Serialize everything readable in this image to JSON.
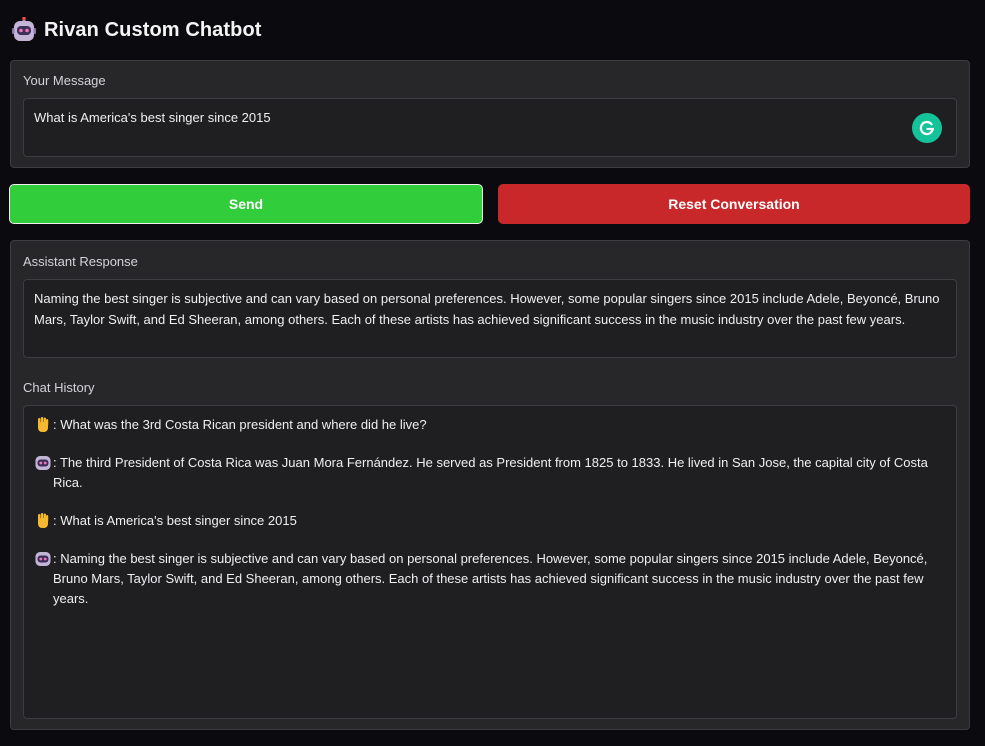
{
  "app": {
    "title": "Rivan Custom Chatbot",
    "icon": "robot-icon"
  },
  "message": {
    "label": "Your Message",
    "value": "What is America's best singer since 2015",
    "grammarly_icon": "grammarly-icon"
  },
  "buttons": {
    "send_label": "Send",
    "reset_label": "Reset Conversation"
  },
  "response": {
    "label": "Assistant Response",
    "text": "Naming the best singer is subjective and can vary based on personal preferences. However, some popular singers since 2015 include Adele, Beyoncé, Bruno Mars, Taylor Swift, and Ed Sheeran, among others. Each of these artists has achieved significant success in the music industry over the past few years."
  },
  "history": {
    "label": "Chat History",
    "entries": [
      {
        "role": "user",
        "icon": "user-hand-icon",
        "text": ": What was the 3rd Costa Rican president and where did he live?"
      },
      {
        "role": "assistant",
        "icon": "robot-icon",
        "text": ": The third President of Costa Rica was Juan Mora Fernández. He served as President from 1825 to 1833. He lived in San Jose, the capital city of Costa Rica."
      },
      {
        "role": "user",
        "icon": "user-hand-icon",
        "text": ": What is America's best singer since 2015"
      },
      {
        "role": "assistant",
        "icon": "robot-icon",
        "text": ": Naming the best singer is subjective and can vary based on personal preferences. However, some popular singers since 2015 include Adele, Beyoncé, Bruno Mars, Taylor Swift, and Ed Sheeran, among others. Each of these artists has achieved significant success in the music industry over the past few years."
      }
    ]
  },
  "colors": {
    "send": "#31cd3a",
    "reset": "#c8282a",
    "panel": "#27272a",
    "background": "#0b0b0f"
  }
}
